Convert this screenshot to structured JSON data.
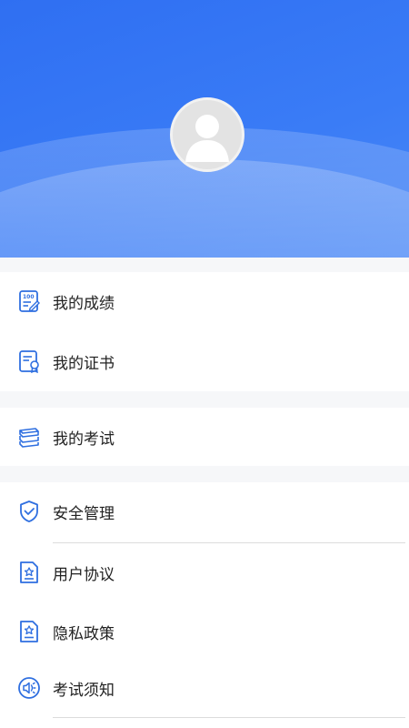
{
  "profile": {
    "avatar_icon": "default-user-avatar",
    "header_color": "#2f6ff2"
  },
  "menu": {
    "scores": {
      "label": "我的成绩",
      "icon": "score-report-icon"
    },
    "certificates": {
      "label": "我的证书",
      "icon": "certificate-icon"
    },
    "exams": {
      "label": "我的考试",
      "icon": "exam-stack-icon"
    },
    "security": {
      "label": "安全管理",
      "icon": "shield-check-icon"
    },
    "user_agreement": {
      "label": "用户协议",
      "icon": "agreement-doc-icon"
    },
    "privacy_policy": {
      "label": "隐私政策",
      "icon": "privacy-doc-icon"
    },
    "exam_notice": {
      "label": "考试须知",
      "icon": "speaker-notice-icon"
    }
  },
  "accent_color": "#2f6fe0"
}
